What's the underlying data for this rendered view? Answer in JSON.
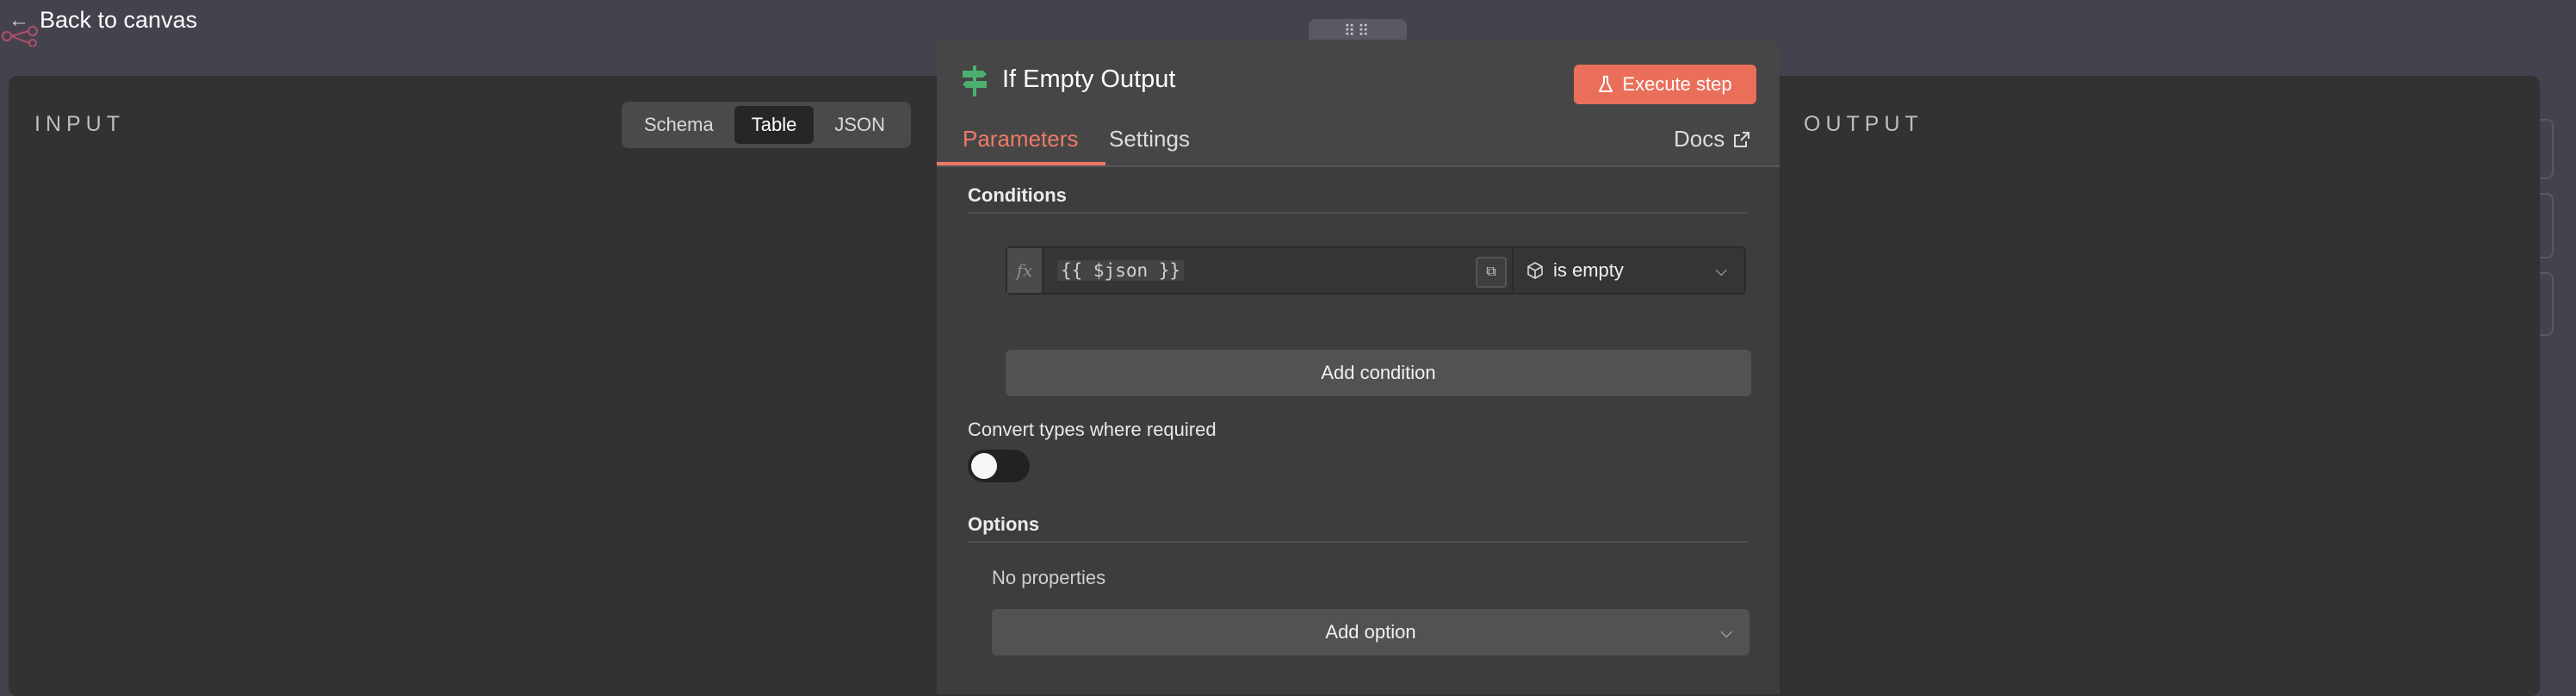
{
  "top_bar": {
    "back_label": "Back to canvas"
  },
  "input_panel": {
    "heading": "INPUT",
    "view_modes": [
      "Schema",
      "Table",
      "JSON"
    ],
    "active_view": "Table"
  },
  "output_panel": {
    "heading": "OUTPUT"
  },
  "node": {
    "title": "If Empty Output",
    "icon": "signpost-icon",
    "icon_color": "#4caf6e",
    "execute_label": "Execute step",
    "execute_icon": "flask-icon",
    "tabs": {
      "parameters": "Parameters",
      "settings": "Settings"
    },
    "active_tab": "Parameters",
    "docs_label": "Docs",
    "conditions": {
      "title": "Conditions",
      "fx_label": "fx",
      "expression": "{{ $json }}",
      "operator_icon": "cube-icon",
      "operator": "is empty",
      "add_condition_label": "Add condition"
    },
    "convert_types": {
      "label": "Convert types where required",
      "enabled": false
    },
    "options": {
      "title": "Options",
      "empty_text": "No properties",
      "add_option_label": "Add option"
    }
  },
  "colors": {
    "accent": "#ee7a66",
    "execute_button": "#ea6f5b",
    "background": "#44424d",
    "panel": "#323232"
  }
}
